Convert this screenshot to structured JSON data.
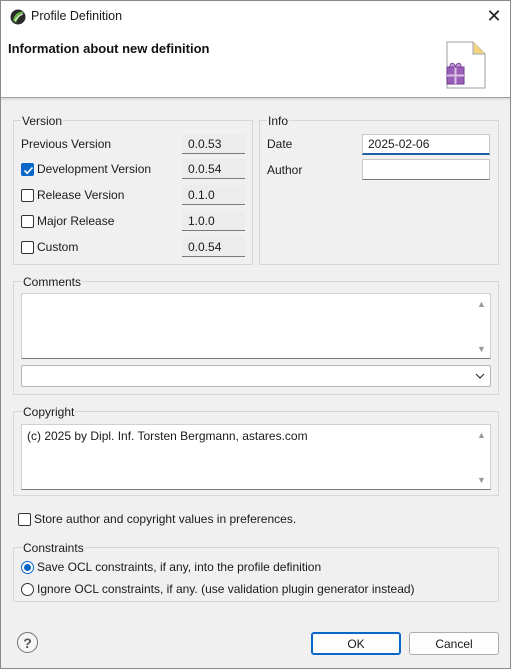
{
  "window": {
    "title": "Profile Definition",
    "close_glyph": "✕"
  },
  "header": {
    "title": "Information about new definition",
    "icon": "profile-package-icon"
  },
  "version": {
    "label": "Version",
    "previous": {
      "label": "Previous Version",
      "value": "0.0.53"
    },
    "rows": [
      {
        "label": "Development Version",
        "value": "0.0.54",
        "checked": true
      },
      {
        "label": "Release Version",
        "value": "0.1.0",
        "checked": false
      },
      {
        "label": "Major Release",
        "value": "1.0.0",
        "checked": false
      },
      {
        "label": "Custom",
        "value": "0.0.54",
        "checked": false
      }
    ]
  },
  "info": {
    "label": "Info",
    "date_label": "Date",
    "date_value": "2025-02-06",
    "author_label": "Author",
    "author_value": ""
  },
  "comments": {
    "label": "Comments",
    "value": "",
    "combo_value": ""
  },
  "copyright": {
    "label": "Copyright",
    "value": "(c) 2025 by Dipl. Inf. Torsten Bergmann, astares.com"
  },
  "store_prefs": {
    "label": "Store author and copyright values in preferences.",
    "checked": false
  },
  "constraints": {
    "label": "Constraints",
    "options": [
      {
        "label": "Save OCL constraints, if any, into the profile definition",
        "selected": true
      },
      {
        "label": "Ignore OCL constraints, if any. (use validation plugin generator instead)",
        "selected": false
      }
    ]
  },
  "buttons": {
    "help": "?",
    "ok": "OK",
    "cancel": "Cancel"
  },
  "colors": {
    "accent": "#0a66c8",
    "background": "#f0f0f0"
  }
}
